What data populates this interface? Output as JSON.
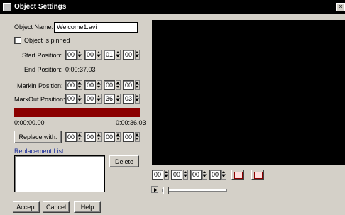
{
  "window": {
    "title": "Object Settings",
    "close_label": "×"
  },
  "form": {
    "object_name_label": "Object Name:",
    "object_name_value": "Welcome1.avi",
    "pinned_label": "Object is pinned",
    "start_position_label": "Start Position:",
    "start_position": [
      "00",
      "00",
      "01",
      "00"
    ],
    "end_position_label": "End Position:",
    "end_position_value": "0:00:37.03",
    "markin_label": "MarkIn Position:",
    "markin_position": [
      "00",
      "00",
      "00",
      "00"
    ],
    "markout_label": "MarkOut Position:",
    "markout_position": [
      "00",
      "00",
      "36",
      "03"
    ],
    "timeline_start": "0:00:00.00",
    "timeline_end": "0:00:36.03",
    "replace_button": "Replace with:",
    "replace_position": [
      "00",
      "00",
      "00",
      "00"
    ],
    "replacement_list_label": "Replacement List:",
    "delete_button": "Delete"
  },
  "player": {
    "position": [
      "00",
      "00",
      "00",
      "00"
    ]
  },
  "buttons": {
    "accept": "Accept",
    "cancel": "Cancel",
    "help": "Help"
  }
}
